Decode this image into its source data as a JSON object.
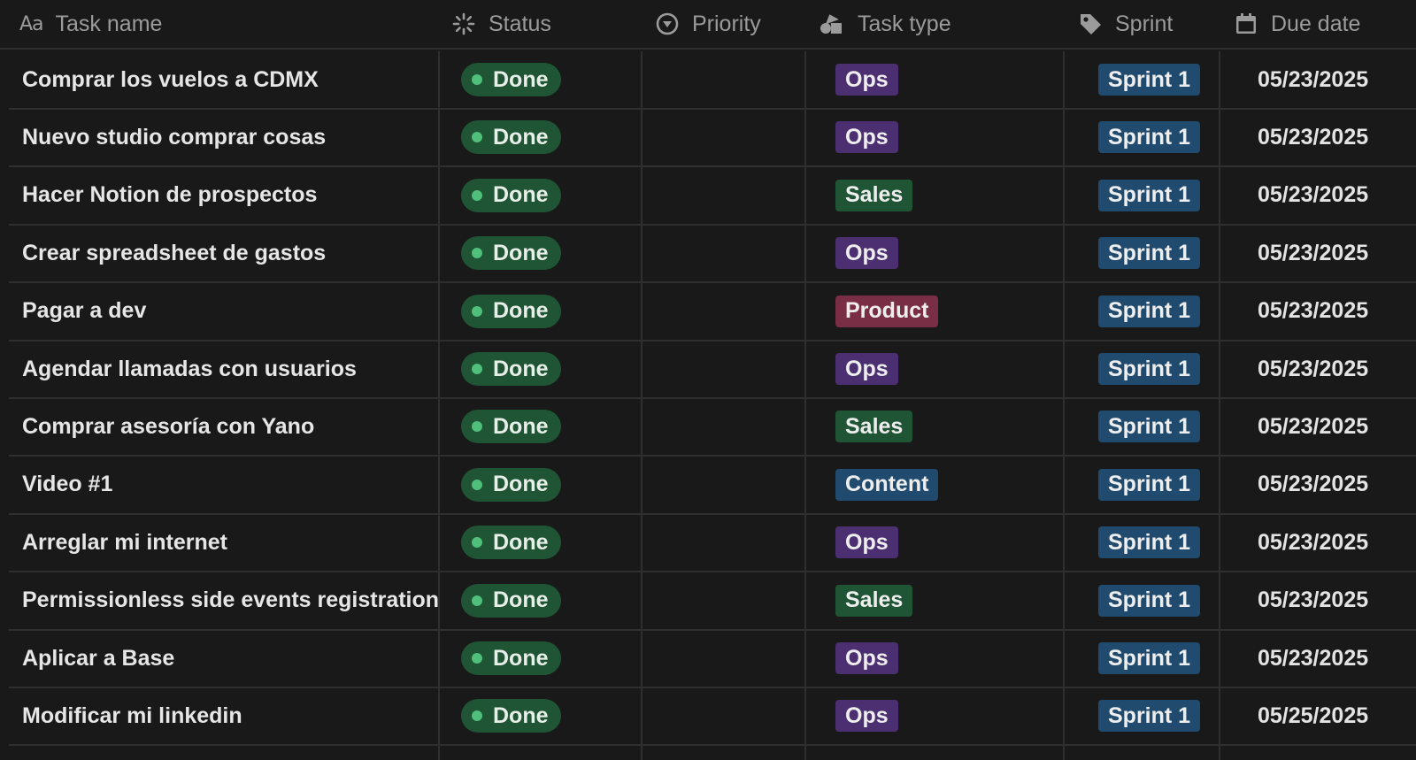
{
  "columns": {
    "task_name": {
      "icon": "Aa",
      "label": "Task name"
    },
    "status": {
      "icon": "status-icon",
      "label": "Status"
    },
    "priority": {
      "icon": "priority-icon",
      "label": "Priority"
    },
    "task_type": {
      "icon": "shapes-icon",
      "label": "Task type"
    },
    "sprint": {
      "icon": "tag-icon",
      "label": "Sprint"
    },
    "due_date": {
      "icon": "calendar-icon",
      "label": "Due date"
    }
  },
  "colors": {
    "background": "#191919",
    "status_done": "#1f5535",
    "status_dot": "#4fbf7a",
    "ops": "#4b2f70",
    "sales": "#1f5535",
    "product": "#7a2e45",
    "content": "#214b6e",
    "sprint": "#214b6e"
  },
  "rows": [
    {
      "name": "Comprar los vuelos a CDMX",
      "status": "Done",
      "priority": "",
      "type": "Ops",
      "sprint": "Sprint 1",
      "due": "05/23/2025"
    },
    {
      "name": "Nuevo studio comprar cosas",
      "status": "Done",
      "priority": "",
      "type": "Ops",
      "sprint": "Sprint 1",
      "due": "05/23/2025"
    },
    {
      "name": "Hacer Notion de prospectos",
      "status": "Done",
      "priority": "",
      "type": "Sales",
      "sprint": "Sprint 1",
      "due": "05/23/2025"
    },
    {
      "name": "Crear spreadsheet de gastos",
      "status": "Done",
      "priority": "",
      "type": "Ops",
      "sprint": "Sprint 1",
      "due": "05/23/2025"
    },
    {
      "name": "Pagar a dev",
      "status": "Done",
      "priority": "",
      "type": "Product",
      "sprint": "Sprint 1",
      "due": "05/23/2025"
    },
    {
      "name": "Agendar llamadas con usuarios",
      "status": "Done",
      "priority": "",
      "type": "Ops",
      "sprint": "Sprint 1",
      "due": "05/23/2025"
    },
    {
      "name": "Comprar asesoría con Yano",
      "status": "Done",
      "priority": "",
      "type": "Sales",
      "sprint": "Sprint 1",
      "due": "05/23/2025"
    },
    {
      "name": "Video #1",
      "status": "Done",
      "priority": "",
      "type": "Content",
      "sprint": "Sprint 1",
      "due": "05/23/2025"
    },
    {
      "name": "Arreglar mi internet",
      "status": "Done",
      "priority": "",
      "type": "Ops",
      "sprint": "Sprint 1",
      "due": "05/23/2025"
    },
    {
      "name": "Permissionless side events registration",
      "status": "Done",
      "priority": "",
      "type": "Sales",
      "sprint": "Sprint 1",
      "due": "05/23/2025"
    },
    {
      "name": "Aplicar a Base",
      "status": "Done",
      "priority": "",
      "type": "Ops",
      "sprint": "Sprint 1",
      "due": "05/23/2025"
    },
    {
      "name": "Modificar mi linkedin",
      "status": "Done",
      "priority": "",
      "type": "Ops",
      "sprint": "Sprint 1",
      "due": "05/25/2025"
    }
  ]
}
